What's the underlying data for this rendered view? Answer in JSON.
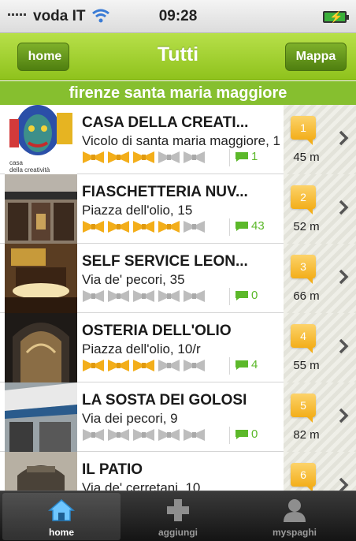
{
  "status_bar": {
    "carrier": "voda IT",
    "time": "09:28"
  },
  "nav": {
    "back_label": "home",
    "title": "Tutti",
    "map_label": "Mappa"
  },
  "location": "firenze santa maria maggiore",
  "places": [
    {
      "name": "CASA DELLA CREATI...",
      "address": "Vicolo di santa maria maggiore, 1",
      "rating": 3,
      "comments": "1",
      "rank": "1",
      "distance": "45 m"
    },
    {
      "name": "FIASCHETTERIA NUV...",
      "address": "Piazza dell'olio, 15",
      "rating": 4,
      "comments": "43",
      "rank": "2",
      "distance": "52 m"
    },
    {
      "name": "SELF SERVICE LEON...",
      "address": "Via de' pecori, 35",
      "rating": 0,
      "comments": "0",
      "rank": "3",
      "distance": "66 m"
    },
    {
      "name": "OSTERIA DELL'OLIO",
      "address": "Piazza dell'olio, 10/r",
      "rating": 3,
      "comments": "4",
      "rank": "4",
      "distance": "55 m"
    },
    {
      "name": "LA SOSTA DEI GOLOSI",
      "address": "Via dei pecori, 9",
      "rating": 0,
      "comments": "0",
      "rank": "5",
      "distance": "82 m"
    },
    {
      "name": "IL PATIO",
      "address": "Via de' cerretani, 10",
      "rank": "6"
    }
  ],
  "tabs": [
    {
      "label": "home",
      "icon": "house-icon",
      "active": true
    },
    {
      "label": "aggiungi",
      "icon": "plus-icon",
      "active": false
    },
    {
      "label": "myspaghi",
      "icon": "person-icon",
      "active": false
    }
  ],
  "colors": {
    "accent_green": "#8fc21c",
    "rating_gold": "#f3ae1a",
    "comment_green": "#5cb82a"
  }
}
